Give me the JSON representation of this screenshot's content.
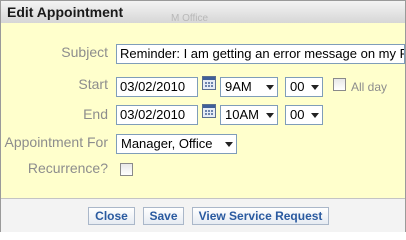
{
  "dialog": {
    "title": "Edit Appointment",
    "background_text": "M  Office"
  },
  "form": {
    "subject_label": "Subject",
    "subject_value": "Reminder: I am getting an error message on my PC",
    "start_label": "Start",
    "start_date": "03/02/2010",
    "start_hour": "9AM",
    "start_minute": "00",
    "all_day_label": "All day",
    "all_day_checked": false,
    "end_label": "End",
    "end_date": "03/02/2010",
    "end_hour": "10AM",
    "end_minute": "00",
    "appointment_for_label": "Appointment For",
    "appointment_for_value": "Manager, Office",
    "recurrence_label": "Recurrence?",
    "recurrence_checked": false
  },
  "footer": {
    "close_label": "Close",
    "save_label": "Save",
    "view_request_label": "View Service Request"
  },
  "icons": {
    "calendar": "calendar-icon",
    "dropdown": "chevron-down-icon"
  },
  "colors": {
    "form_background": "#ffffcc",
    "button_text": "#2a5aa0",
    "label_text": "#8d8d8d"
  }
}
